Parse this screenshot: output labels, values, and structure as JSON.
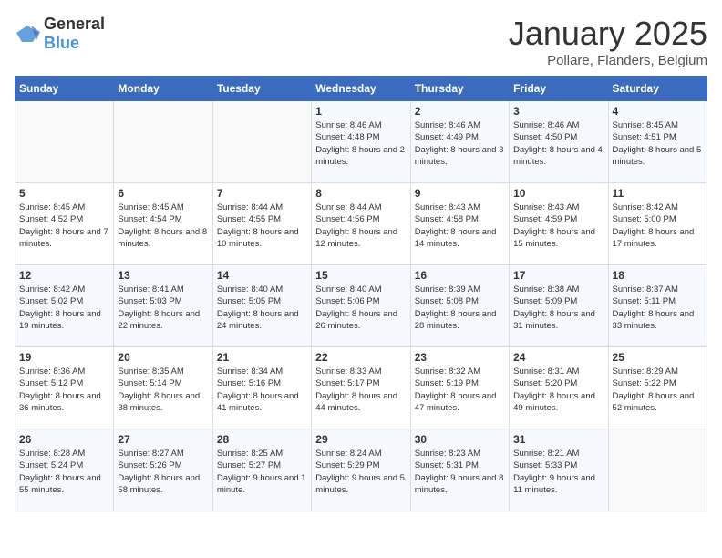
{
  "logo": {
    "general": "General",
    "blue": "Blue"
  },
  "header": {
    "month": "January 2025",
    "location": "Pollare, Flanders, Belgium"
  },
  "weekdays": [
    "Sunday",
    "Monday",
    "Tuesday",
    "Wednesday",
    "Thursday",
    "Friday",
    "Saturday"
  ],
  "weeks": [
    [
      {
        "day": "",
        "sunrise": "",
        "sunset": "",
        "daylight": ""
      },
      {
        "day": "",
        "sunrise": "",
        "sunset": "",
        "daylight": ""
      },
      {
        "day": "",
        "sunrise": "",
        "sunset": "",
        "daylight": ""
      },
      {
        "day": "1",
        "sunrise": "Sunrise: 8:46 AM",
        "sunset": "Sunset: 4:48 PM",
        "daylight": "Daylight: 8 hours and 2 minutes."
      },
      {
        "day": "2",
        "sunrise": "Sunrise: 8:46 AM",
        "sunset": "Sunset: 4:49 PM",
        "daylight": "Daylight: 8 hours and 3 minutes."
      },
      {
        "day": "3",
        "sunrise": "Sunrise: 8:46 AM",
        "sunset": "Sunset: 4:50 PM",
        "daylight": "Daylight: 8 hours and 4 minutes."
      },
      {
        "day": "4",
        "sunrise": "Sunrise: 8:45 AM",
        "sunset": "Sunset: 4:51 PM",
        "daylight": "Daylight: 8 hours and 5 minutes."
      }
    ],
    [
      {
        "day": "5",
        "sunrise": "Sunrise: 8:45 AM",
        "sunset": "Sunset: 4:52 PM",
        "daylight": "Daylight: 8 hours and 7 minutes."
      },
      {
        "day": "6",
        "sunrise": "Sunrise: 8:45 AM",
        "sunset": "Sunset: 4:54 PM",
        "daylight": "Daylight: 8 hours and 8 minutes."
      },
      {
        "day": "7",
        "sunrise": "Sunrise: 8:44 AM",
        "sunset": "Sunset: 4:55 PM",
        "daylight": "Daylight: 8 hours and 10 minutes."
      },
      {
        "day": "8",
        "sunrise": "Sunrise: 8:44 AM",
        "sunset": "Sunset: 4:56 PM",
        "daylight": "Daylight: 8 hours and 12 minutes."
      },
      {
        "day": "9",
        "sunrise": "Sunrise: 8:43 AM",
        "sunset": "Sunset: 4:58 PM",
        "daylight": "Daylight: 8 hours and 14 minutes."
      },
      {
        "day": "10",
        "sunrise": "Sunrise: 8:43 AM",
        "sunset": "Sunset: 4:59 PM",
        "daylight": "Daylight: 8 hours and 15 minutes."
      },
      {
        "day": "11",
        "sunrise": "Sunrise: 8:42 AM",
        "sunset": "Sunset: 5:00 PM",
        "daylight": "Daylight: 8 hours and 17 minutes."
      }
    ],
    [
      {
        "day": "12",
        "sunrise": "Sunrise: 8:42 AM",
        "sunset": "Sunset: 5:02 PM",
        "daylight": "Daylight: 8 hours and 19 minutes."
      },
      {
        "day": "13",
        "sunrise": "Sunrise: 8:41 AM",
        "sunset": "Sunset: 5:03 PM",
        "daylight": "Daylight: 8 hours and 22 minutes."
      },
      {
        "day": "14",
        "sunrise": "Sunrise: 8:40 AM",
        "sunset": "Sunset: 5:05 PM",
        "daylight": "Daylight: 8 hours and 24 minutes."
      },
      {
        "day": "15",
        "sunrise": "Sunrise: 8:40 AM",
        "sunset": "Sunset: 5:06 PM",
        "daylight": "Daylight: 8 hours and 26 minutes."
      },
      {
        "day": "16",
        "sunrise": "Sunrise: 8:39 AM",
        "sunset": "Sunset: 5:08 PM",
        "daylight": "Daylight: 8 hours and 28 minutes."
      },
      {
        "day": "17",
        "sunrise": "Sunrise: 8:38 AM",
        "sunset": "Sunset: 5:09 PM",
        "daylight": "Daylight: 8 hours and 31 minutes."
      },
      {
        "day": "18",
        "sunrise": "Sunrise: 8:37 AM",
        "sunset": "Sunset: 5:11 PM",
        "daylight": "Daylight: 8 hours and 33 minutes."
      }
    ],
    [
      {
        "day": "19",
        "sunrise": "Sunrise: 8:36 AM",
        "sunset": "Sunset: 5:12 PM",
        "daylight": "Daylight: 8 hours and 36 minutes."
      },
      {
        "day": "20",
        "sunrise": "Sunrise: 8:35 AM",
        "sunset": "Sunset: 5:14 PM",
        "daylight": "Daylight: 8 hours and 38 minutes."
      },
      {
        "day": "21",
        "sunrise": "Sunrise: 8:34 AM",
        "sunset": "Sunset: 5:16 PM",
        "daylight": "Daylight: 8 hours and 41 minutes."
      },
      {
        "day": "22",
        "sunrise": "Sunrise: 8:33 AM",
        "sunset": "Sunset: 5:17 PM",
        "daylight": "Daylight: 8 hours and 44 minutes."
      },
      {
        "day": "23",
        "sunrise": "Sunrise: 8:32 AM",
        "sunset": "Sunset: 5:19 PM",
        "daylight": "Daylight: 8 hours and 47 minutes."
      },
      {
        "day": "24",
        "sunrise": "Sunrise: 8:31 AM",
        "sunset": "Sunset: 5:20 PM",
        "daylight": "Daylight: 8 hours and 49 minutes."
      },
      {
        "day": "25",
        "sunrise": "Sunrise: 8:29 AM",
        "sunset": "Sunset: 5:22 PM",
        "daylight": "Daylight: 8 hours and 52 minutes."
      }
    ],
    [
      {
        "day": "26",
        "sunrise": "Sunrise: 8:28 AM",
        "sunset": "Sunset: 5:24 PM",
        "daylight": "Daylight: 8 hours and 55 minutes."
      },
      {
        "day": "27",
        "sunrise": "Sunrise: 8:27 AM",
        "sunset": "Sunset: 5:26 PM",
        "daylight": "Daylight: 8 hours and 58 minutes."
      },
      {
        "day": "28",
        "sunrise": "Sunrise: 8:25 AM",
        "sunset": "Sunset: 5:27 PM",
        "daylight": "Daylight: 9 hours and 1 minute."
      },
      {
        "day": "29",
        "sunrise": "Sunrise: 8:24 AM",
        "sunset": "Sunset: 5:29 PM",
        "daylight": "Daylight: 9 hours and 5 minutes."
      },
      {
        "day": "30",
        "sunrise": "Sunrise: 8:23 AM",
        "sunset": "Sunset: 5:31 PM",
        "daylight": "Daylight: 9 hours and 8 minutes."
      },
      {
        "day": "31",
        "sunrise": "Sunrise: 8:21 AM",
        "sunset": "Sunset: 5:33 PM",
        "daylight": "Daylight: 9 hours and 11 minutes."
      },
      {
        "day": "",
        "sunrise": "",
        "sunset": "",
        "daylight": ""
      }
    ]
  ]
}
